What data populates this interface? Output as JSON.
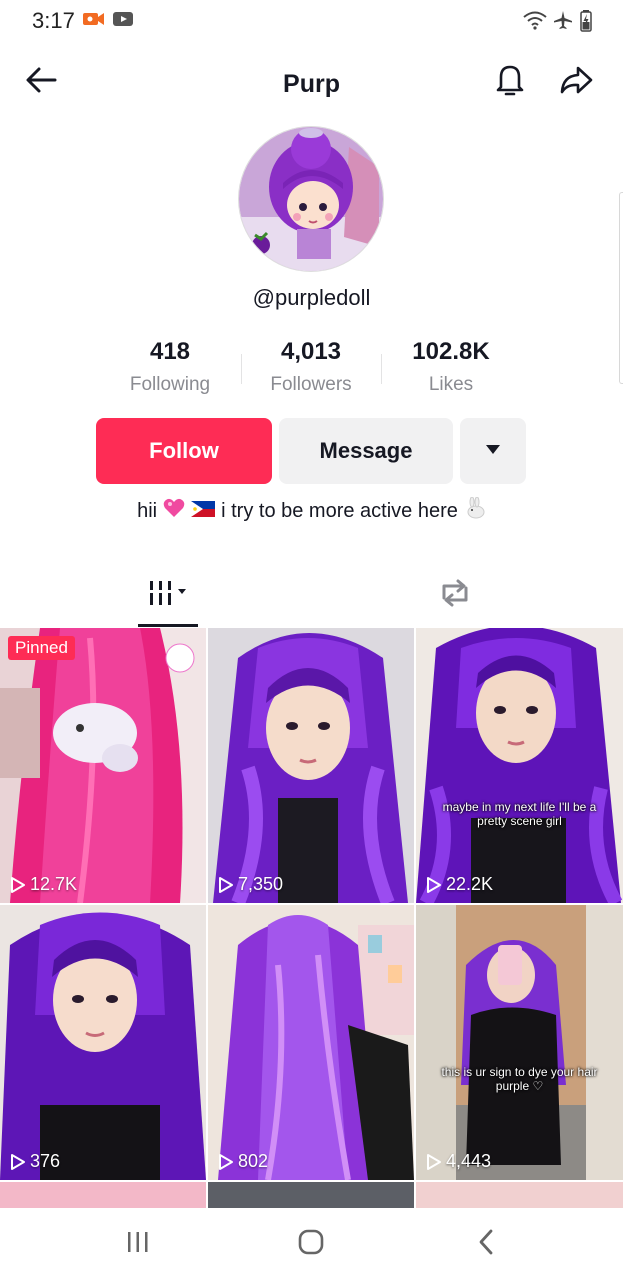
{
  "status_bar": {
    "time": "3:17",
    "icons": [
      "video-record-icon",
      "youtube-icon",
      "wifi-icon",
      "airplane-icon",
      "battery-charging-icon"
    ]
  },
  "header": {
    "title": "Purp",
    "back_icon": "back-arrow-icon",
    "bell_icon": "bell-icon",
    "share_icon": "share-icon"
  },
  "profile": {
    "username": "@purpledoll",
    "stats": [
      {
        "value": "418",
        "label": "Following"
      },
      {
        "value": "4,013",
        "label": "Followers"
      },
      {
        "value": "102.8K",
        "label": "Likes"
      }
    ],
    "follow_label": "Follow",
    "message_label": "Message",
    "bio_start": "hii",
    "bio_end": "i try to be more active here",
    "accent_color": "#fe2c55"
  },
  "tabs": {
    "videos_icon": "videos-grid-icon",
    "reposts_icon": "repost-icon"
  },
  "videos": [
    {
      "views": "12.7K",
      "pinned": "Pinned",
      "caption": ""
    },
    {
      "views": "7,350",
      "pinned": "",
      "caption": ""
    },
    {
      "views": "22.2K",
      "pinned": "",
      "caption": "maybe in my next life I'll be a pretty scene girl"
    },
    {
      "views": "376",
      "pinned": "",
      "caption": ""
    },
    {
      "views": "802",
      "pinned": "",
      "caption": ""
    },
    {
      "views": "4,443",
      "pinned": "",
      "caption": "this is ur sign to dye your hair purple ♡"
    }
  ],
  "navbar": {
    "icons": [
      "recent-apps-icon",
      "home-icon",
      "back-icon"
    ]
  }
}
